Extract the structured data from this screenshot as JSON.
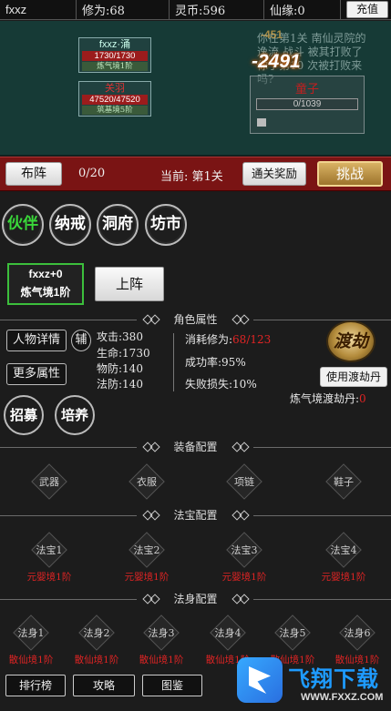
{
  "topbar": {
    "player": "fxxz",
    "cultivation": "修为:68",
    "coins": "灵币:596",
    "fate": "仙缘:0",
    "recharge": "充值"
  },
  "battle": {
    "ally1": {
      "name": "fxxz·涌",
      "hp": "1730/1730",
      "level": "炼气境1阶"
    },
    "ally2": {
      "name": "关羽",
      "hp": "47520/47520",
      "level": "筑基境5阶"
    },
    "log": "你在第1关 南仙灵院的逸流 战斗 被其打败了 你于第10 次被打败来吗?",
    "damage_faint": "-451",
    "damage": "-2491",
    "enemy": {
      "name": "童子",
      "hp": "0/1039"
    }
  },
  "stage": {
    "deploy": "布阵",
    "count": "0/20",
    "current": "当前: 第1关",
    "reward": "通关奖励",
    "challenge": "挑战"
  },
  "tabs": [
    "伙伴",
    "纳戒",
    "洞府",
    "坊市"
  ],
  "character": {
    "name": "fxxz+0",
    "realm": "炼气境1阶"
  },
  "onstage": "上阵",
  "sections": {
    "attributes": "角色属性",
    "equipment": "装备配置",
    "treasure": "法宝配置",
    "body": "法身配置"
  },
  "buttons": {
    "details": "人物详情",
    "assist": "辅",
    "more": "更多属性",
    "recruit": "招募",
    "train": "培养",
    "use_pill": "使用渡劫丹"
  },
  "stats": {
    "attack": "攻击:380",
    "hp": "生命:1730",
    "phys_def": "物防:140",
    "mag_def": "法防:140"
  },
  "tribulation": {
    "emblem": "渡劫",
    "cost_label": "消耗修为:",
    "cost_value": "68/123",
    "success": "成功率:95%",
    "fail": "失败损失:10%",
    "pill_label": "炼气境渡劫丹:",
    "pill_count": "0"
  },
  "equipment": [
    "武器",
    "衣服",
    "项链",
    "鞋子"
  ],
  "treasures": [
    {
      "name": "法宝1",
      "req": "元婴境1阶"
    },
    {
      "name": "法宝2",
      "req": "元婴境1阶"
    },
    {
      "name": "法宝3",
      "req": "元婴境1阶"
    },
    {
      "name": "法宝4",
      "req": "元婴境1阶"
    }
  ],
  "bodies": [
    {
      "name": "法身1",
      "req": "散仙境1阶"
    },
    {
      "name": "法身2",
      "req": "散仙境1阶"
    },
    {
      "name": "法身3",
      "req": "散仙境1阶"
    },
    {
      "name": "法身4",
      "req": "散仙境1阶"
    },
    {
      "name": "法身5",
      "req": "散仙境1阶"
    },
    {
      "name": "法身6",
      "req": "散仙境1阶"
    }
  ],
  "bottom_nav": [
    "排行榜",
    "攻略",
    "图鉴"
  ],
  "watermark": {
    "brand": "飞翔下载",
    "url": "WWW.FXXZ.COM"
  },
  "colors": {
    "accent_green": "#3ad83a",
    "stage_red": "#7a1414",
    "warn_red": "#e02424",
    "battle_bg": "#163a36"
  }
}
